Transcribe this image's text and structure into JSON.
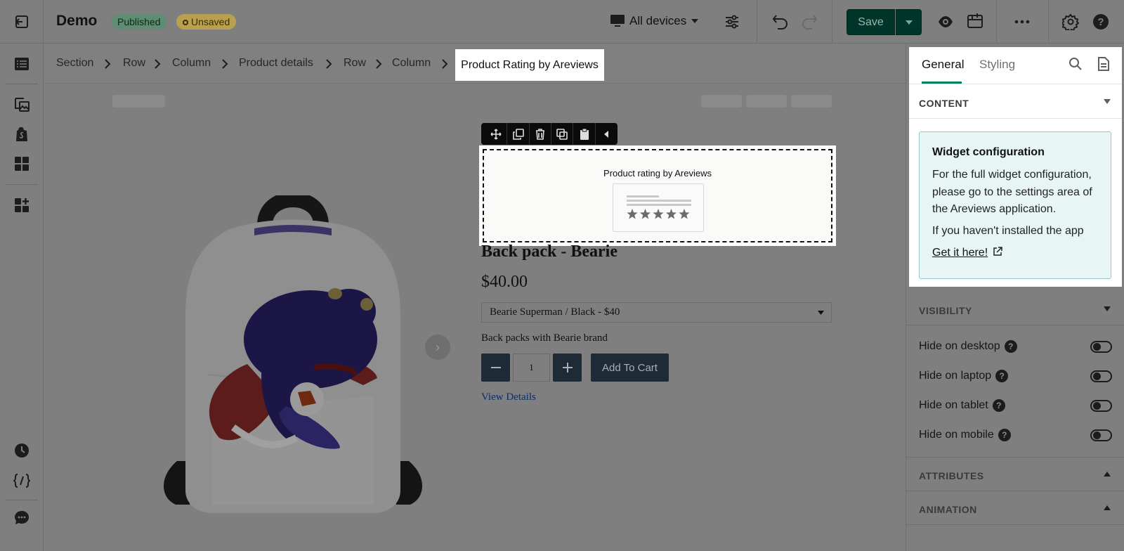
{
  "app": {
    "title": "Demo",
    "status_published": "Published",
    "status_unsaved": "Unsaved",
    "device_selector": "All devices",
    "save_label": "Save"
  },
  "breadcrumb": {
    "items": [
      "Section",
      "Row",
      "Column",
      "Product details",
      "Row",
      "Column"
    ],
    "active": "Product Rating by Areviews"
  },
  "widget": {
    "title": "Product rating by Areviews",
    "star_count": 5
  },
  "product": {
    "name": "Back pack - Bearie",
    "price": "$40.00",
    "variant_selected": "Bearie Superman / Black - $40",
    "description": "Back packs with Bearie brand",
    "quantity": "1",
    "add_to_cart": "Add To Cart",
    "view_details": "View Details"
  },
  "panel": {
    "tabs": [
      "General",
      "Styling"
    ],
    "active_tab": "General",
    "content_section": "CONTENT",
    "info": {
      "title": "Widget configuration",
      "text": "For the full widget configuration, please go to the settings area of the Areviews application.",
      "text2": "If you haven't installed the app",
      "link": "Get it here!"
    },
    "visibility_section": "VISIBILITY",
    "toggles": [
      {
        "label": "Hide on desktop",
        "on": false
      },
      {
        "label": "Hide on laptop",
        "on": false
      },
      {
        "label": "Hide on tablet",
        "on": false
      },
      {
        "label": "Hide on mobile",
        "on": false
      }
    ],
    "attributes_section": "ATTRIBUTES",
    "animation_section": "ANIMATION"
  },
  "colors": {
    "accent": "#008060",
    "save_bg": "#00362a",
    "overlay": "#7f7f7f",
    "info_bg": "#e8f5f5"
  }
}
